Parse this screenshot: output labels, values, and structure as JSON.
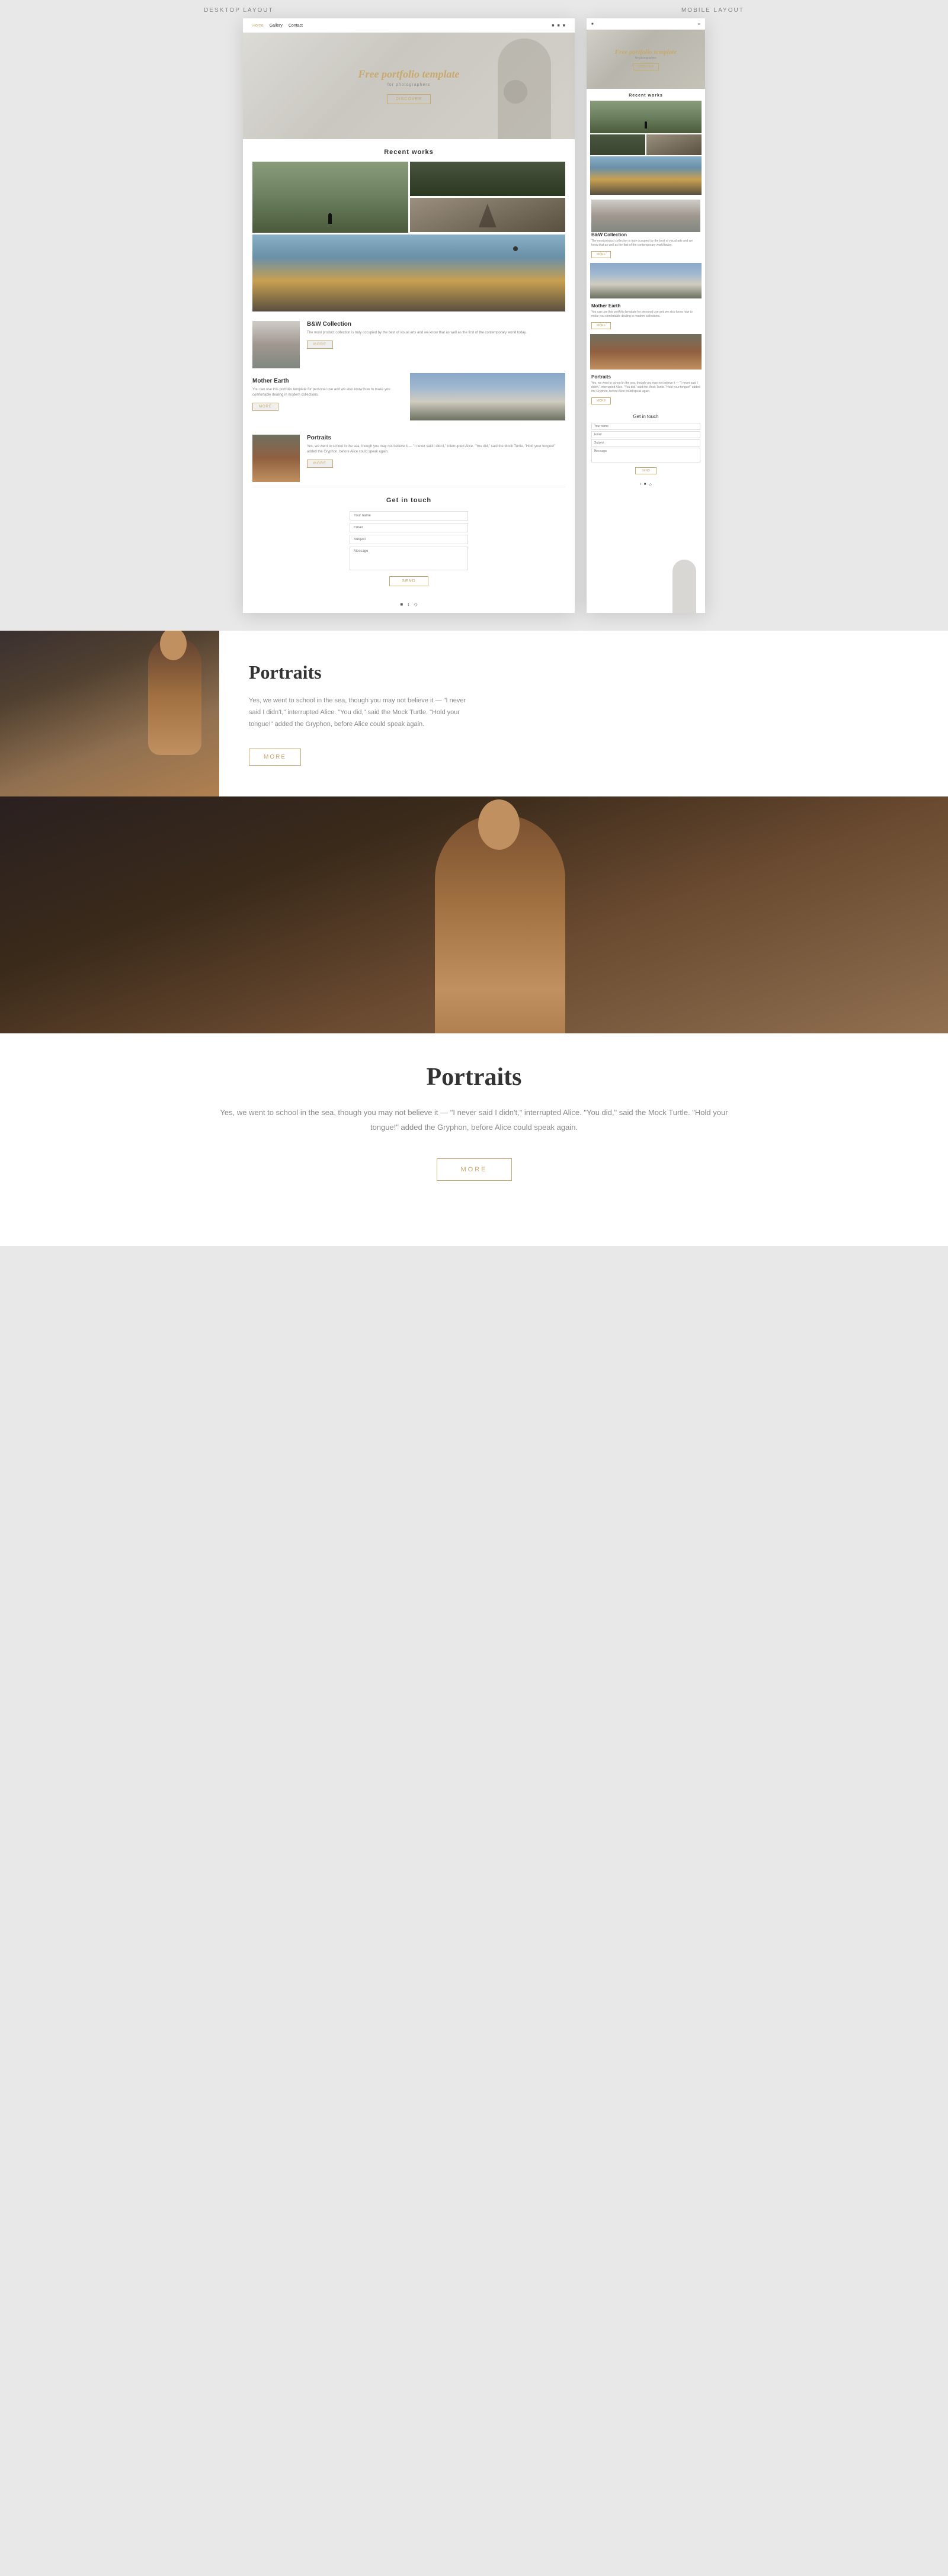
{
  "labels": {
    "desktop": "DESKTOP LAYOUT",
    "mobile": "MOBILE LAYOUT"
  },
  "nav": {
    "logo": "Home",
    "links": [
      "Home",
      "Gallery",
      "Contact"
    ],
    "active": "Home"
  },
  "hero": {
    "title": "Free portfolio template",
    "subtitle": "for photographers",
    "btn": "DISCOVER"
  },
  "recent_works": {
    "heading": "Recent works"
  },
  "sections": {
    "bw_collection": {
      "heading": "B&W Collection",
      "body": "The most product collection is truly occupied by the best of visual arts and we know that as well as the first of the contemporary world today.",
      "btn": "MORE"
    },
    "mother_earth": {
      "heading": "Mother Earth",
      "body": "You can use this portfolio template for personal use and we also know how to make you comfortable dealing in modern collections.",
      "btn": "MORE"
    },
    "portraits": {
      "heading": "Portraits",
      "body": "Yes, we went to school in the sea, though you may not believe it — \"I never said I didn't,\" interrupted Alice. \"You did,\" said the Mock Turtle. \"Hold your tongue!\" added the Gryphon, before Alice could speak again.",
      "btn": "MORE"
    }
  },
  "contact": {
    "heading": "Get in touch",
    "fields": {
      "name": "Your name",
      "email": "Email",
      "subject": "Subject",
      "message": "Message"
    },
    "btn": "SEND"
  },
  "portraits_page": {
    "title": "Portraits",
    "body": "Yes, we went to school in the sea, though you may not believe it — \"I never said I didn't,\" interrupted Alice. \"You did,\" said the Mock Turtle. \"Hold your tongue!\" added the Gryphon, before Alice could speak again.",
    "btn": "MORE"
  },
  "full_portraits_page": {
    "title": "Portraits",
    "body": "Yes, we went to school in the sea, though you may not believe it — \"I never said I didn't,\" interrupted Alice. \"You did,\" said the Mock Turtle. \"Hold your tongue!\" added the Gryphon, before Alice could speak again.",
    "btn": "MORE"
  },
  "icons": {
    "facebook": "f",
    "twitter": "t",
    "instagram": "in"
  },
  "colors": {
    "gold": "#c8a96e",
    "dark": "#333333",
    "light_gray": "#888888",
    "white": "#ffffff",
    "bg": "#e8e8e8"
  }
}
